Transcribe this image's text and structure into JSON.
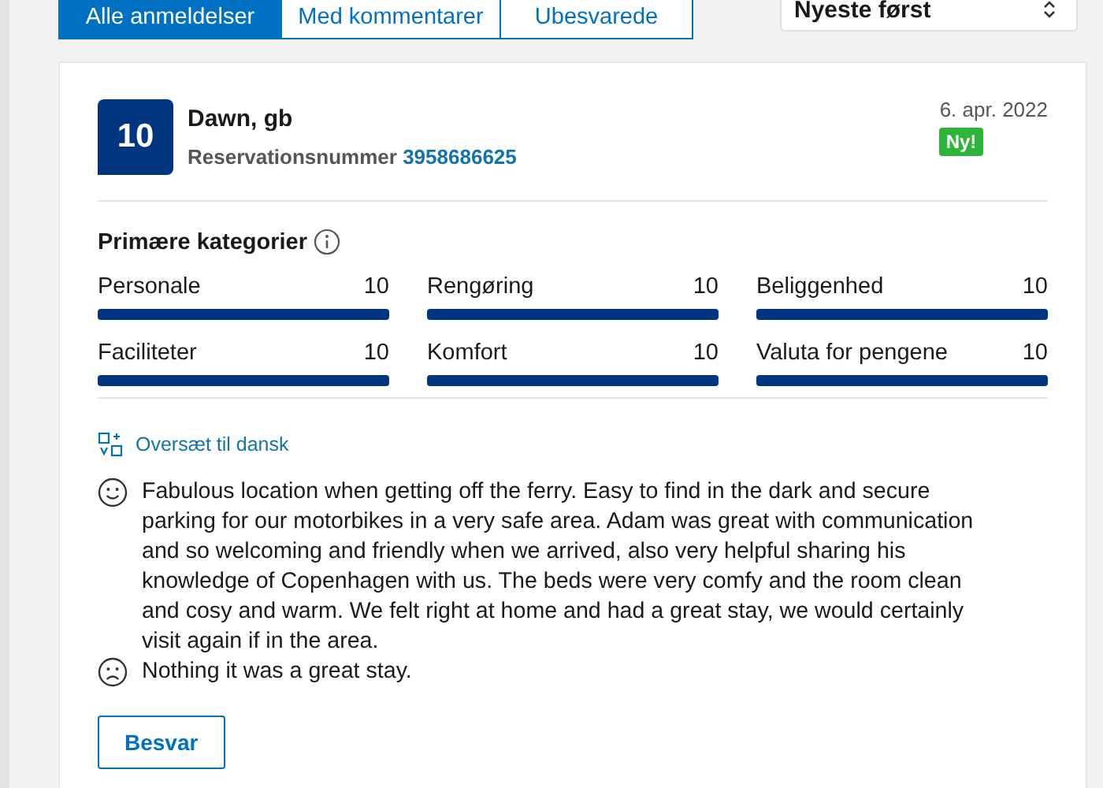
{
  "tabs": [
    {
      "label": "Alle anmeldelser",
      "selected": true
    },
    {
      "label": "Med kommentarer",
      "selected": false
    },
    {
      "label": "Ubesvarede",
      "selected": false
    }
  ],
  "sort": {
    "value": "Nyeste først"
  },
  "review": {
    "score": "10",
    "name": "Dawn, gb",
    "reservation_label": "Reservationsnummer",
    "reservation_number": "3958686625",
    "date": "6. apr. 2022",
    "badge": "Ny!",
    "categories_title": "Primære kategorier",
    "categories": [
      {
        "name": "Personale",
        "score": "10",
        "level": 1
      },
      {
        "name": "Rengøring",
        "score": "10",
        "level": 1
      },
      {
        "name": "Beliggenhed",
        "score": "10",
        "level": 1
      },
      {
        "name": "Faciliteter",
        "score": "10",
        "level": 1
      },
      {
        "name": "Komfort",
        "score": "10",
        "level": 1
      },
      {
        "name": "Valuta for pengene",
        "score": "10",
        "level": 1
      }
    ],
    "translate_link": "Oversæt til dansk",
    "comments": [
      {
        "kind": "positive",
        "text": "Fabulous location when getting off the ferry. Easy to find in the dark and secure parking for our motorbikes in a very safe area. Adam was great with communication and so welcoming and friendly when we arrived, also very helpful sharing his knowledge of Copenhagen with us. The beds were very comfy and the room clean and cosy and warm. We felt right at home and had a great stay, we would certainly visit again if in the area."
      },
      {
        "kind": "negative",
        "text": "Nothing it was a great stay."
      }
    ],
    "reply_button": "Besvar"
  }
}
